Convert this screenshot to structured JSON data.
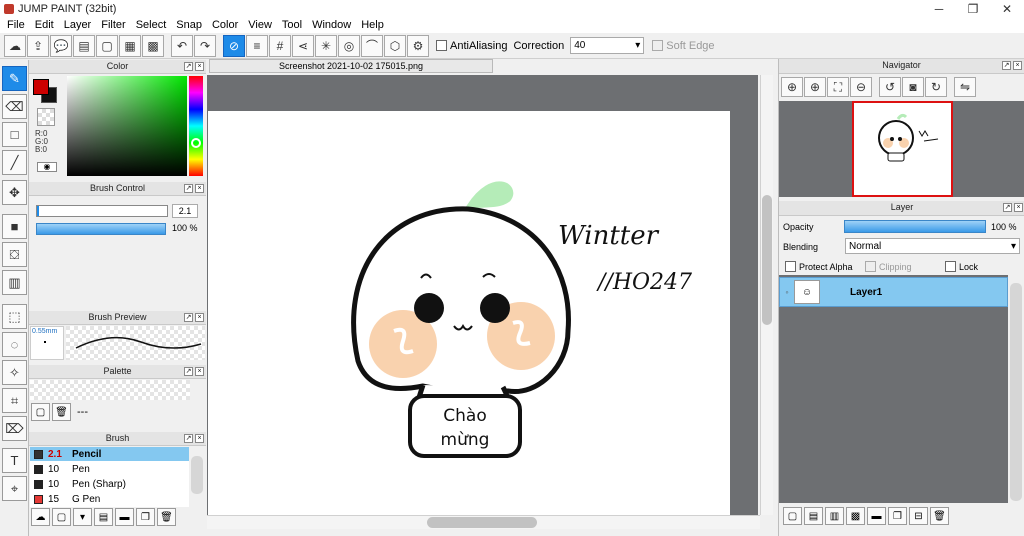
{
  "app": {
    "title": "JUMP PAINT (32bit)"
  },
  "menu": [
    "File",
    "Edit",
    "Layer",
    "Filter",
    "Select",
    "Snap",
    "Color",
    "View",
    "Tool",
    "Window",
    "Help"
  ],
  "toolbar": {
    "antialiasing_label": "AntiAliasing",
    "correction_label": "Correction",
    "correction_value": "40",
    "soft_edge_label": "Soft Edge"
  },
  "color_panel": {
    "title": "Color",
    "r": "R:0",
    "g": "G:0",
    "b": "B:0"
  },
  "brush_control": {
    "title": "Brush Control",
    "size": "2.1",
    "opacity": "100 %"
  },
  "brush_preview": {
    "title": "Brush Preview",
    "size": "0.55mm"
  },
  "palette": {
    "title": "Palette",
    "value": "---"
  },
  "brush_panel": {
    "title": "Brush",
    "items": [
      {
        "size": "2.1",
        "name": "Pencil",
        "selected": true,
        "color": "#333333"
      },
      {
        "size": "10",
        "name": "Pen",
        "selected": false,
        "color": "#222222"
      },
      {
        "size": "10",
        "name": "Pen (Sharp)",
        "selected": false,
        "color": "#222222"
      },
      {
        "size": "15",
        "name": "G Pen",
        "selected": false,
        "color": "#e53935"
      }
    ]
  },
  "document": {
    "tab": "Screenshot 2021-10-02 175015.png"
  },
  "canvas_text": {
    "line1": "Wintter",
    "line2": "//HO247",
    "sign1": "Chào",
    "sign2": "mừng"
  },
  "navigator": {
    "title": "Navigator"
  },
  "layer_panel": {
    "title": "Layer",
    "opacity_label": "Opacity",
    "opacity_value": "100 %",
    "blending_label": "Blending",
    "blending_value": "Normal",
    "protect_alpha": "Protect Alpha",
    "clipping": "Clipping",
    "lock": "Lock",
    "layers": [
      {
        "name": "Layer1"
      }
    ]
  },
  "colors": {
    "accent": "#1e8be8",
    "selection": "#84c8f0",
    "fg_color": "#cc0000",
    "bg_color": "#111111"
  }
}
